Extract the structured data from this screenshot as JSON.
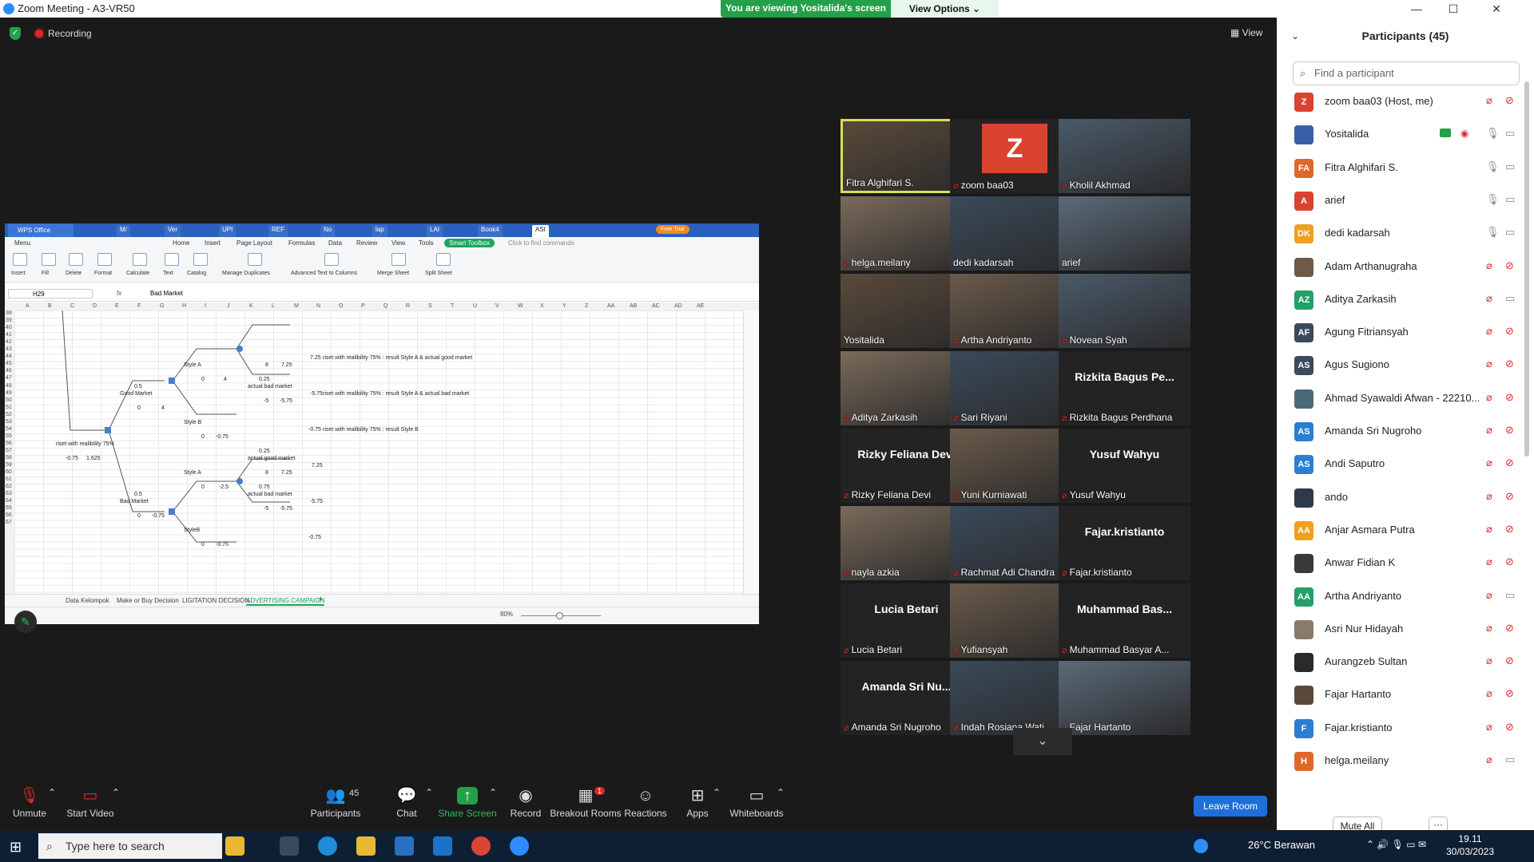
{
  "window": {
    "title": "Zoom Meeting - A3-VR50",
    "banner_text": "You are viewing Yositalida's screen",
    "view_options": "View Options ⌄",
    "minimize": "—",
    "maximize": "☐",
    "close": "✕"
  },
  "meeting": {
    "recording_label": "Recording",
    "view_label": "View"
  },
  "shared_screen": {
    "app_brand": "WPS Office",
    "doc_tabs": [
      "M/",
      "Ver",
      "UPI",
      "REF",
      "No",
      "lap",
      "LAI",
      "Book4",
      "ASI"
    ],
    "free_trial": "Free Trial",
    "menu_items": [
      "Menu",
      "Home",
      "Insert",
      "Page Layout",
      "Formulas",
      "Data",
      "Review",
      "View",
      "Tools"
    ],
    "smart_toolbox": "Smart Toolbox",
    "find_commands": "Click to find commands",
    "ribbon_items": [
      "Insert",
      "Fill",
      "Delete",
      "Format",
      "Calculate",
      "Text",
      "Catalog",
      "Manage Duplicates",
      "Advanced Text to Columns",
      "Merge Sheet",
      "Split Sheet"
    ],
    "cell_ref": "H29",
    "fx": "fx",
    "formula_value": "Bad Market",
    "columns": [
      "A",
      "B",
      "C",
      "D",
      "E",
      "F",
      "G",
      "H",
      "I",
      "J",
      "K",
      "L",
      "M",
      "N",
      "O",
      "P",
      "Q",
      "R",
      "S",
      "T",
      "U",
      "V",
      "W",
      "X",
      "Y",
      "Z",
      "AA",
      "AB",
      "AC",
      "AD",
      "AE"
    ],
    "rows": [
      "38",
      "39",
      "40",
      "41",
      "42",
      "43",
      "44",
      "45",
      "46",
      "47",
      "48",
      "49",
      "50",
      "51",
      "52",
      "53",
      "54",
      "55",
      "56",
      "57",
      "58",
      "59",
      "60",
      "61",
      "62",
      "63",
      "64",
      "65",
      "66",
      "67"
    ],
    "cells": {
      "style_a_1": "Style A",
      "v8_1": "8",
      "v725_1": "7.25",
      "res1": "7.25",
      "res1_text": "riset with realibility 75% : result Style A & actual good market",
      "v0_1": "0",
      "v4_1": "4",
      "v05_1": "0.5",
      "good_market": "Good Market",
      "v025_1": "0.25",
      "actual_bad_market_1": "actual bad market",
      "res2": "-5.75",
      "res2_text": "riset with realibility 75% : result Style A & actual bad market",
      "v0_2": "0",
      "v4_2": "4",
      "vneg5_1": "-5",
      "vneg575_1": "-5.75",
      "style_b_1": "Style B",
      "res3": "-0.75",
      "res3_text": "riset with realibility 75% : result Style B",
      "v0_3": "0",
      "vneg075_1": "-0.75",
      "riset_label": "riset with realibility 75%",
      "vneg075_2": "-0.75",
      "v1625": "1.625",
      "v025_2": "0.25",
      "actual_good_market": "actual good market",
      "res4": "7.25",
      "style_a_2": "Style A",
      "v8_2": "8",
      "v725_2": "7.25",
      "v0_4": "0",
      "vneg25": "-2.5",
      "v05_2": "0.5",
      "bad_market": "Bad Market",
      "v075": "0.75",
      "actual_bad_market_2": "actual bad market",
      "res5": "-5.75",
      "vneg5_2": "-5",
      "vneg575_2": "-5.75",
      "v0_5": "0",
      "vneg075_3": "-0.75",
      "style_b_2": "StyleB",
      "res6": "-0.75",
      "v0_6": "0",
      "vneg075_4": "-0.75"
    },
    "sheet_tabs": [
      "Data Kelompok",
      "Make or Buy Decision",
      "LIGITATION DECISION",
      "ADVERTISING CAMPAIGN"
    ],
    "zoom_level": "80%"
  },
  "tiles": [
    {
      "name": "Fitra Alghifari S.",
      "muted": false,
      "active": true,
      "photo": true
    },
    {
      "name": "zoom baa03",
      "muted": true,
      "avatar_letter": "Z"
    },
    {
      "name": "Kholil Akhmad",
      "muted": true,
      "photo": true
    },
    {
      "name": "helga.meilany",
      "muted": true,
      "photo": true
    },
    {
      "name": "dedi kadarsah",
      "muted": false,
      "photo": true
    },
    {
      "name": "arief",
      "muted": false,
      "photo": true
    },
    {
      "name": "Yositalida",
      "muted": false,
      "photo": true
    },
    {
      "name": "Artha Andriyanto",
      "muted": true,
      "photo": true
    },
    {
      "name": "Novean Syah",
      "muted": true,
      "photo": true
    },
    {
      "name": "Aditya Zarkasih",
      "muted": true,
      "photo": true
    },
    {
      "name": "Sari Riyani",
      "muted": true,
      "photo": true
    },
    {
      "name": "Rizkita Bagus Perdhana",
      "muted": true,
      "big": "Rizkita Bagus Pe..."
    },
    {
      "name": "Rizky Feliana Devi",
      "muted": true,
      "big": "Rizky Feliana Devi"
    },
    {
      "name": "Yuni Kurniawati",
      "muted": true,
      "photo": true
    },
    {
      "name": "Yusuf Wahyu",
      "muted": true,
      "big": "Yusuf Wahyu"
    },
    {
      "name": "nayla azkia",
      "muted": true,
      "photo": true
    },
    {
      "name": "Rachmat Adi Chandra",
      "muted": true,
      "photo": true
    },
    {
      "name": "Fajar.kristianto",
      "muted": true,
      "big": "Fajar.kristianto"
    },
    {
      "name": "Lucia Betari",
      "muted": true,
      "big": "Lucia Betari"
    },
    {
      "name": "Yufiansyah",
      "muted": true,
      "photo": true
    },
    {
      "name": "Muhammad Basyar A...",
      "muted": true,
      "big": "Muhammad Bas..."
    },
    {
      "name": "Amanda Sri Nugroho",
      "muted": true,
      "big": "Amanda Sri Nu..."
    },
    {
      "name": "Indah Rosiana Wati",
      "muted": true,
      "photo": true
    },
    {
      "name": "Fajar Hartanto",
      "muted": true,
      "photo": true
    }
  ],
  "toolbar": {
    "unmute": "Unmute",
    "start_video": "Start Video",
    "participants": "Participants",
    "participants_count": "45",
    "chat": "Chat",
    "share_screen": "Share Screen",
    "record": "Record",
    "breakout_rooms": "Breakout Rooms",
    "breakout_badge": "1",
    "reactions": "Reactions",
    "apps": "Apps",
    "whiteboards": "Whiteboards",
    "leave_room": "Leave Room"
  },
  "panel": {
    "title": "Participants (45)",
    "search_placeholder": "Find a participant",
    "mute_all": "Mute All",
    "more": "···",
    "participants": [
      {
        "initials": "Z",
        "color": "#d9432f",
        "name": "zoom baa03 (Host, me)",
        "mic": "off",
        "cam": "off"
      },
      {
        "initials": "",
        "color": "#3a5fa8",
        "name": "Yositalida",
        "mic": "on",
        "cam": "on",
        "sharing": true
      },
      {
        "initials": "FA",
        "color": "#e0672a",
        "name": "Fitra Alghifari S.",
        "mic": "on",
        "cam": "on"
      },
      {
        "initials": "A",
        "color": "#d9432f",
        "name": "arief",
        "mic": "on",
        "cam": "on"
      },
      {
        "initials": "DK",
        "color": "#f0a020",
        "name": "dedi kadarsah",
        "mic": "on",
        "cam": "on"
      },
      {
        "initials": "",
        "color": "#6d5a48",
        "name": "Adam Arthanugraha",
        "mic": "off",
        "cam": "off"
      },
      {
        "initials": "AZ",
        "color": "#23a06a",
        "name": "Aditya Zarkasih",
        "mic": "off",
        "cam": "on"
      },
      {
        "initials": "AF",
        "color": "#3d4a5c",
        "name": "Agung Fitriansyah",
        "mic": "off",
        "cam": "off"
      },
      {
        "initials": "AS",
        "color": "#3d4a5c",
        "name": "Agus Sugiono",
        "mic": "off",
        "cam": "off"
      },
      {
        "initials": "",
        "color": "#4a6a7a",
        "name": "Ahmad Syawaldi Afwan - 22210...",
        "mic": "off",
        "cam": "off"
      },
      {
        "initials": "AS",
        "color": "#2a7fd0",
        "name": "Amanda Sri Nugroho",
        "mic": "off",
        "cam": "off"
      },
      {
        "initials": "AS",
        "color": "#2a7fd0",
        "name": "Andi Saputro",
        "mic": "off",
        "cam": "off"
      },
      {
        "initials": "",
        "color": "#2d3a4c",
        "name": "ando",
        "mic": "off",
        "cam": "off"
      },
      {
        "initials": "AA",
        "color": "#f0a020",
        "name": "Anjar Asmara Putra",
        "mic": "off",
        "cam": "off"
      },
      {
        "initials": "",
        "color": "#3a3a3a",
        "name": "Anwar Fidian K",
        "mic": "off",
        "cam": "off"
      },
      {
        "initials": "AA",
        "color": "#23a06a",
        "name": "Artha Andriyanto",
        "mic": "off",
        "cam": "on"
      },
      {
        "initials": "",
        "color": "#8a7a6a",
        "name": "Asri Nur Hidayah",
        "mic": "off",
        "cam": "off"
      },
      {
        "initials": "",
        "color": "#2a2a2a",
        "name": "Aurangzeb Sultan",
        "mic": "off",
        "cam": "off"
      },
      {
        "initials": "",
        "color": "#5a4a3a",
        "name": "Fajar Hartanto",
        "mic": "off",
        "cam": "off"
      },
      {
        "initials": "F",
        "color": "#2a7fd0",
        "name": "Fajar.kristianto",
        "mic": "off",
        "cam": "off"
      },
      {
        "initials": "H",
        "color": "#e0672a",
        "name": "helga.meilany",
        "mic": "off",
        "cam": "on"
      }
    ]
  },
  "taskbar": {
    "search_placeholder": "Type here to search",
    "weather": "26°C  Berawan",
    "time": "19.11",
    "date": "30/03/2023"
  }
}
